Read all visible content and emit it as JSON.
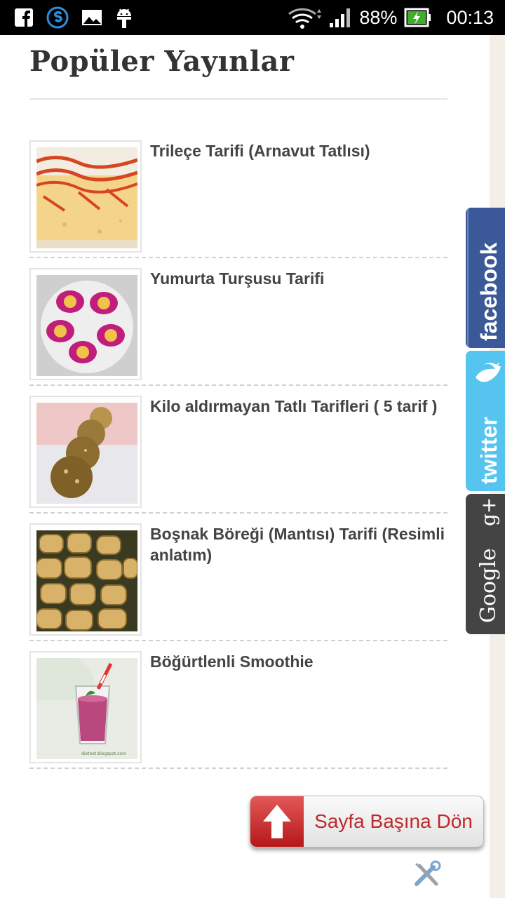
{
  "status_bar": {
    "battery": "88%",
    "time": "00:13",
    "icons": [
      "facebook-icon",
      "skype-icon",
      "image-icon",
      "android-icon",
      "wifi-icon",
      "signal-icon",
      "battery-charging-icon"
    ]
  },
  "section": {
    "title": "Popüler Yayınlar"
  },
  "posts": [
    {
      "title": "Trileçe Tarifi (Arnavut Tatlısı)"
    },
    {
      "title": "Yumurta Turşusu Tarifi"
    },
    {
      "title": "Kilo aldırmayan Tatlı Tarifleri ( 5 tarif )"
    },
    {
      "title": "Boşnak Böreği (Mantısı) Tarifi (Resimli anlatım)"
    },
    {
      "title": "Böğürtlenli Smoothie"
    }
  ],
  "social": {
    "facebook": "facebook",
    "twitter": "twitter",
    "google": "Google",
    "google_plus": "g+"
  },
  "back_to_top": {
    "label": "Sayfa Başına Dön"
  },
  "thumb_credit": "dietnet.blogspot.com",
  "colors": {
    "facebook": "#3b5998",
    "twitter": "#55c4ef",
    "google": "#444444",
    "accent_red": "#c0282a"
  }
}
